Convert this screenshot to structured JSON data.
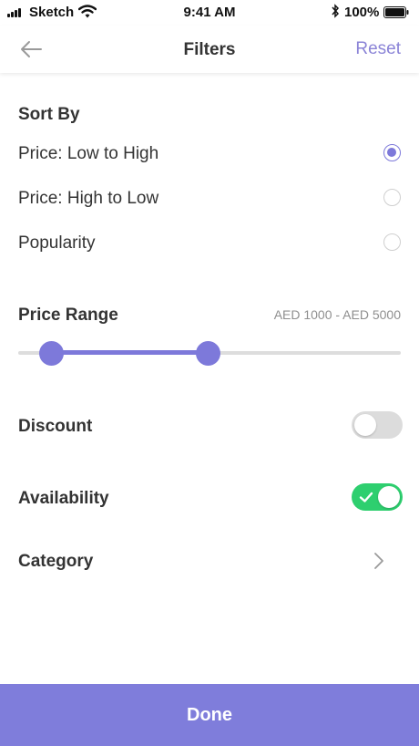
{
  "status_bar": {
    "carrier": "Sketch",
    "time": "9:41 AM",
    "battery": "100%"
  },
  "nav": {
    "title": "Filters",
    "reset_label": "Reset"
  },
  "sort_by": {
    "title": "Sort By",
    "options": [
      {
        "label": "Price: Low to High",
        "selected": true
      },
      {
        "label": "Price: High to Low",
        "selected": false
      },
      {
        "label": "Popularity",
        "selected": false
      }
    ]
  },
  "price_range": {
    "title": "Price Range",
    "value_label": "AED 1000 - AED 5000"
  },
  "discount": {
    "label": "Discount",
    "enabled": false
  },
  "availability": {
    "label": "Availability",
    "enabled": true
  },
  "category": {
    "label": "Category"
  },
  "done_label": "Done",
  "colors": {
    "accent": "#7d79da",
    "toggle_on": "#2ecf6f",
    "toggle_off": "#dcdcdc",
    "reset": "#8b84d7"
  }
}
